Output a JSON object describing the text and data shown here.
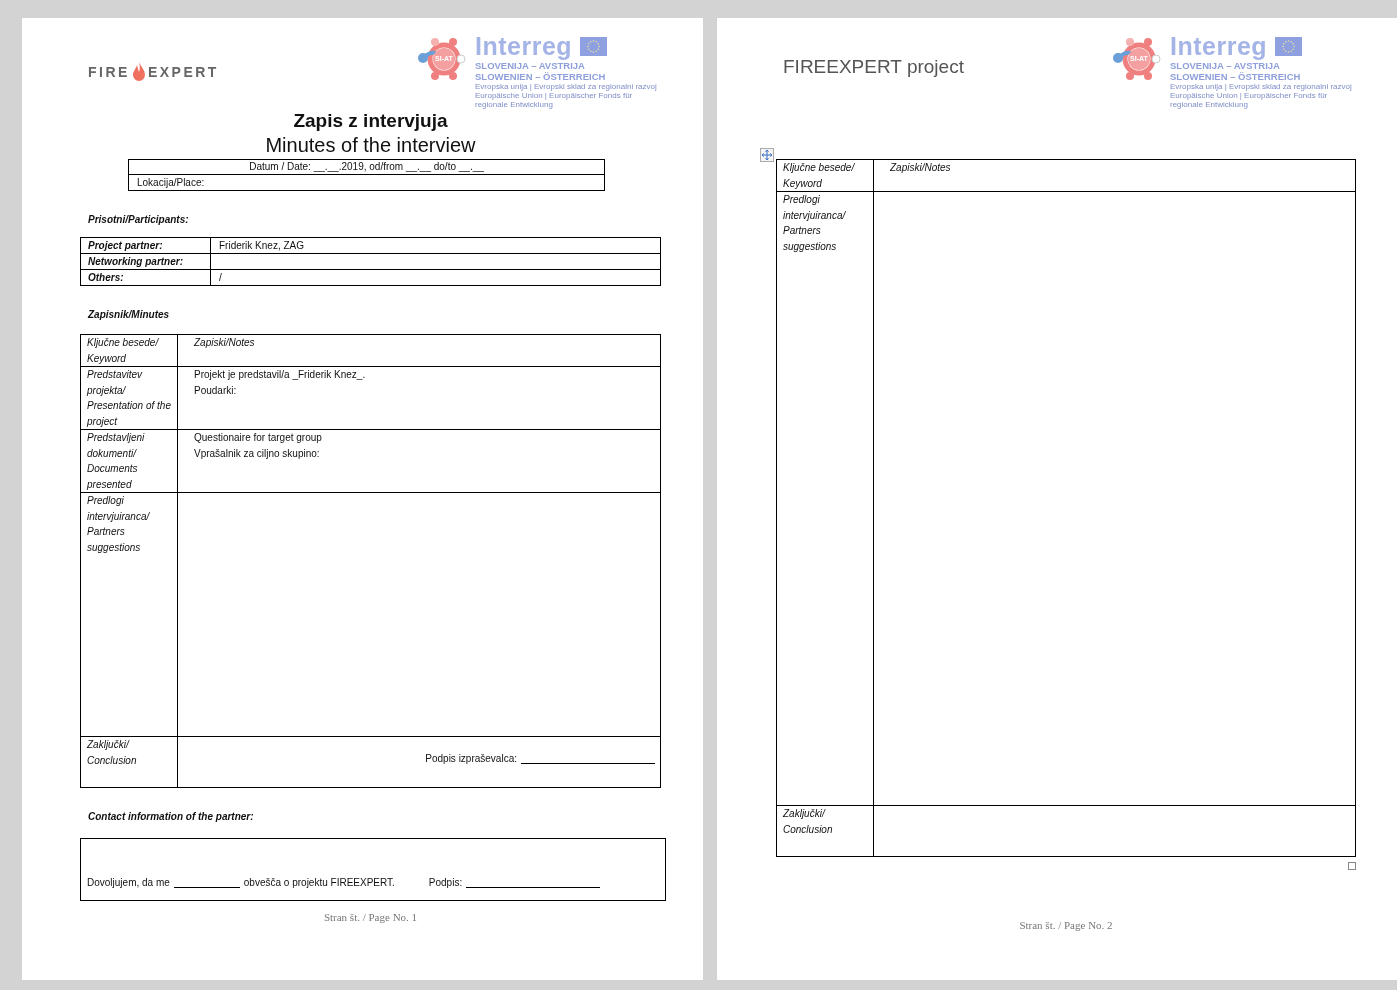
{
  "page1": {
    "brand_logo": {
      "left_word": "FIRE",
      "right_word": "EXPERT"
    },
    "program_logo": {
      "badge": "SI-AT",
      "name": "Interreg",
      "line1": "SLOVENIJA – AVSTRIJA",
      "line2": "SLOWENIEN – ÖSTERREICH",
      "fine_print": [
        "Evropska unija  |  Evropski sklad za regionalni razvoj",
        "Europäische Union | Europäischer Fonds für regionale Entwicklung"
      ]
    },
    "title": "Zapis z intervjuja",
    "subtitle": "Minutes of the interview",
    "date_line": "Datum / Date: __.__.2019, od/from __.__ do/to __.__",
    "place_line": "Lokacija/Place:",
    "participants_heading": "Prisotni/Participants:",
    "participants": [
      {
        "label": "Project partner:",
        "value": "Friderik Knez, ZAG"
      },
      {
        "label": "Networking partner:"
      },
      {
        "label": "Others:",
        "value": "/"
      }
    ],
    "minutes_heading": "Zapisnik/Minutes",
    "minutes": [
      {
        "kind": "header",
        "keyword": "Ključne besede/ Keyword",
        "notes": [
          "Zapiski/Notes"
        ]
      },
      {
        "kind": "notes",
        "keyword": "Predstavitev projekta/ Presentation of the project",
        "notes": [
          "Projekt je predstavil/a _Friderik Knez_.",
          "Poudarki:"
        ]
      },
      {
        "kind": "notes",
        "keyword": "Predstavljeni dokumenti/ Documents presented",
        "notes": [
          "Questionaire for target group",
          "Vprašalnik za ciljno skupino:"
        ]
      },
      {
        "kind": "open",
        "keyword": "Predlogi intervjuiranca/ Partners suggestions"
      },
      {
        "kind": "signature",
        "keyword": "Zaključki/ Conclusion",
        "signature_label": "Podpis izpraševalca:"
      }
    ],
    "contact_heading": "Contact information of the partner:",
    "consent": {
      "before": "Dovoljujem, da me",
      "after": "obvešča o projektu FIREEXPERT.",
      "signature_label": "Podpis:"
    },
    "footer": "Stran št. / Page No. 1"
  },
  "page2": {
    "header_title": "FIREEXPERT project",
    "program_logo": {
      "badge": "SI-AT",
      "name": "Interreg",
      "line1": "SLOVENIJA – AVSTRIJA",
      "line2": "SLOWENIEN – ÖSTERREICH",
      "fine_print": [
        "Evropska unija  |  Evropski sklad za regionalni razvoj",
        "Europäische Union | Europäischer Fonds für regionale Entwicklung"
      ]
    },
    "minutes": [
      {
        "kind": "header",
        "keyword": "Ključne besede/ Keyword",
        "notes": [
          "Zapiski/Notes"
        ]
      },
      {
        "kind": "open",
        "keyword": "Predlogi intervjuiranca/ Partners suggestions"
      },
      {
        "kind": "closing",
        "keyword": "Zaključki/ Conclusion"
      }
    ],
    "footer": "Stran št. / Page No. 2"
  }
}
